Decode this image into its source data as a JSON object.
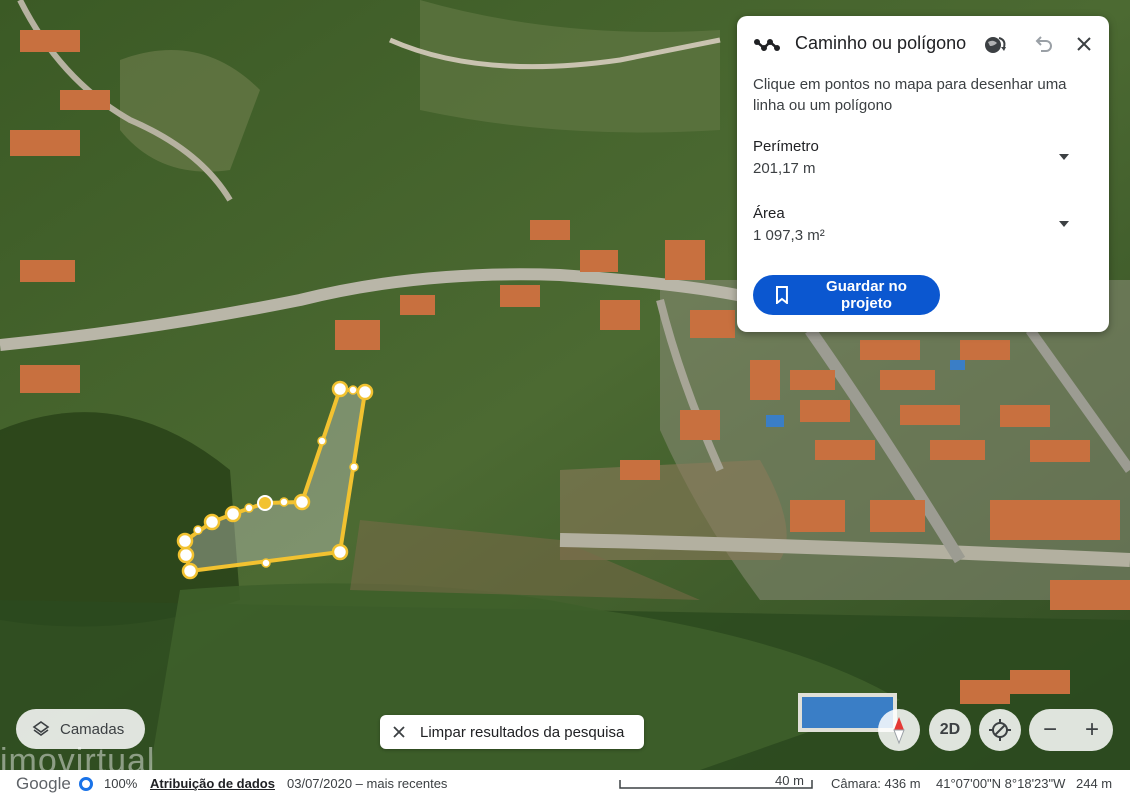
{
  "panel": {
    "title": "Caminho ou polígono",
    "instruction": "Clique em pontos no mapa para desenhar uma linha ou um polígono",
    "perimeter_label": "Perímetro",
    "perimeter_value": "201,17 m",
    "area_label": "Área",
    "area_value": "1 097,3 m²",
    "save_label": "Guardar no projeto"
  },
  "controls": {
    "layers_label": "Camadas",
    "clear_label": "Limpar resultados da pesquisa",
    "mode_2d_label": "2D",
    "zoom_out": "−",
    "zoom_in": "+"
  },
  "watermark": "imovirtual",
  "status": {
    "logo": "Google",
    "load_pct": "100%",
    "attribution": "Atribuição de dados",
    "imagery_date": "03/07/2020 – mais recentes",
    "scale_label": "40 m",
    "camera": "Câmara: 436 m",
    "coords": "41°07'00\"N 8°18'23\"W",
    "altitude": "244 m"
  },
  "colors": {
    "accent": "#0b57d0",
    "polygon": "#f2c230"
  }
}
